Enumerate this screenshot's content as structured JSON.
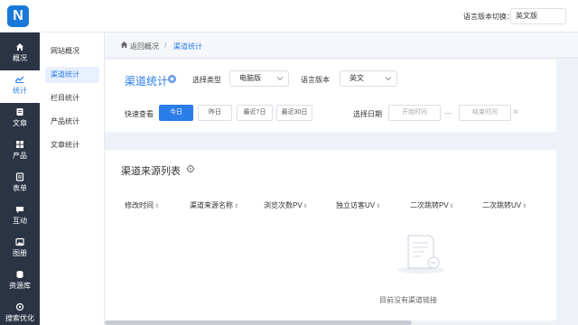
{
  "app": {
    "logo_letter": "N"
  },
  "header": {
    "lang_label": "语言版本切换：",
    "lang_value": "英文版"
  },
  "sidebar": {
    "items": [
      {
        "label": "概况",
        "icon": "home-icon"
      },
      {
        "label": "统计",
        "icon": "chart-icon",
        "active": true
      },
      {
        "label": "文章",
        "icon": "article-icon"
      },
      {
        "label": "产品",
        "icon": "product-icon"
      },
      {
        "label": "表单",
        "icon": "form-icon"
      },
      {
        "label": "互动",
        "icon": "chat-icon"
      },
      {
        "label": "图册",
        "icon": "album-icon"
      },
      {
        "label": "资源库",
        "icon": "database-icon"
      },
      {
        "label": "搜索优化",
        "icon": "seo-icon"
      }
    ]
  },
  "subnav": {
    "items": [
      {
        "label": "网站概况"
      },
      {
        "label": "渠道统计",
        "active": true
      },
      {
        "label": "栏目统计"
      },
      {
        "label": "产品统计"
      },
      {
        "label": "文章统计"
      }
    ]
  },
  "breadcrumb": {
    "back": "返回概况",
    "separator": "/",
    "current": "渠道统计"
  },
  "filter": {
    "title": "渠道统计",
    "type_label": "选择类型",
    "type_value": "电脑版",
    "version_label": "语言版本",
    "version_value": "英文",
    "quick_label": "快速查看",
    "quick_buttons": [
      "今日",
      "昨日",
      "最近7日",
      "最近30日"
    ],
    "date_label": "选择日期",
    "start_placeholder": "开始时间",
    "dash": "—",
    "end_placeholder": "结束时间",
    "clear": "×"
  },
  "list": {
    "title": "渠道来源列表",
    "columns": [
      "修改时间",
      "渠道来源名称",
      "浏览次数PV",
      "独立访客UV",
      "二次跳转PV",
      "二次跳转UV"
    ],
    "empty_text": "目前没有渠道链接"
  },
  "colors": {
    "accent": "#2b7de9",
    "sidebar_bg": "#2b3445"
  }
}
